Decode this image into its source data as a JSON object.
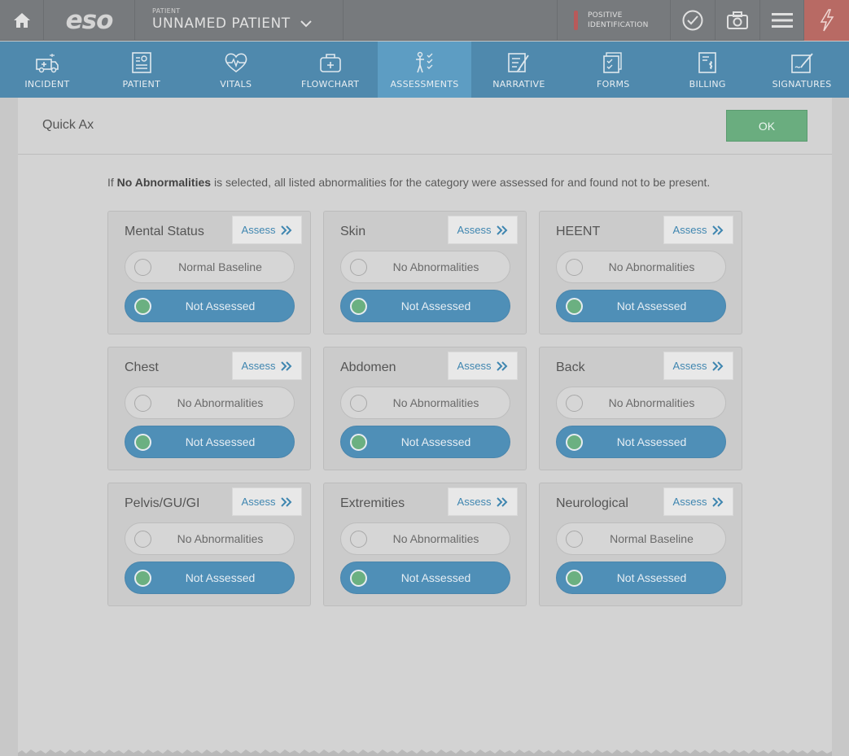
{
  "topbar": {
    "logo": "eso",
    "patient_label": "PATIENT",
    "patient_name": "UNNAMED PATIENT",
    "positive_id_line1": "POSITIVE",
    "positive_id_line2": "IDENTIFICATION",
    "icons": [
      "home-icon",
      "chevron-down-icon",
      "alert-icon",
      "check-circle-icon",
      "camera-icon",
      "hamburger-menu-icon",
      "lightning-icon"
    ],
    "alert_color": "#b86a64"
  },
  "nav": {
    "items": [
      {
        "label": "INCIDENT",
        "icon": "ambulance-icon"
      },
      {
        "label": "PATIENT",
        "icon": "patient-card-icon"
      },
      {
        "label": "VITALS",
        "icon": "heart-pulse-icon"
      },
      {
        "label": "FLOWCHART",
        "icon": "medkit-icon"
      },
      {
        "label": "ASSESSMENTS",
        "icon": "body-checklist-icon"
      },
      {
        "label": "NARRATIVE",
        "icon": "pen-document-icon"
      },
      {
        "label": "FORMS",
        "icon": "forms-icon"
      },
      {
        "label": "BILLING",
        "icon": "billing-icon"
      },
      {
        "label": "SIGNATURES",
        "icon": "signature-icon"
      }
    ],
    "active": "ASSESSMENTS",
    "color": "#4f89ad"
  },
  "panel": {
    "title": "Quick Ax",
    "ok_label": "OK",
    "note_prefix": "If ",
    "note_bold": "No Abnormalities",
    "note_suffix": " is selected, all listed abnormalities for the category were assessed for and found not to be present."
  },
  "cards": [
    {
      "title": "Mental Status",
      "assess": "Assess",
      "option": "Normal Baseline",
      "selected": "Not Assessed"
    },
    {
      "title": "Skin",
      "assess": "Assess",
      "option": "No Abnormalities",
      "selected": "Not Assessed"
    },
    {
      "title": "HEENT",
      "assess": "Assess",
      "option": "No Abnormalities",
      "selected": "Not Assessed"
    },
    {
      "title": "Chest",
      "assess": "Assess",
      "option": "No Abnormalities",
      "selected": "Not Assessed"
    },
    {
      "title": "Abdomen",
      "assess": "Assess",
      "option": "No Abnormalities",
      "selected": "Not Assessed"
    },
    {
      "title": "Back",
      "assess": "Assess",
      "option": "No Abnormalities",
      "selected": "Not Assessed"
    },
    {
      "title": "Pelvis/GU/GI",
      "assess": "Assess",
      "option": "No Abnormalities",
      "selected": "Not Assessed"
    },
    {
      "title": "Extremities",
      "assess": "Assess",
      "option": "No Abnormalities",
      "selected": "Not Assessed"
    },
    {
      "title": "Neurological",
      "assess": "Assess",
      "option": "Normal Baseline",
      "selected": "Not Assessed"
    }
  ]
}
